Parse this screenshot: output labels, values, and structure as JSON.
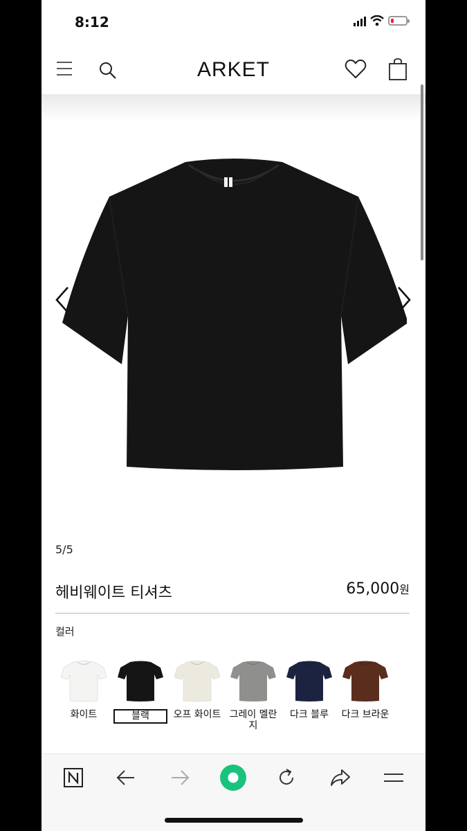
{
  "status": {
    "time": "8:12"
  },
  "brand": "ARKET",
  "gallery": {
    "counter": "5/5",
    "image_alt": "heavyweight-tshirt-black"
  },
  "product": {
    "title": "헤비웨이트 티셔츠",
    "price": "65,000",
    "currency": "원"
  },
  "colors": {
    "label": "컬러",
    "options": [
      {
        "label": "화이트",
        "hex": "#f4f4f2",
        "selected": false
      },
      {
        "label": "블랙",
        "hex": "#151515",
        "selected": true
      },
      {
        "label": "오프 화이트",
        "hex": "#ece9de",
        "selected": false
      },
      {
        "label": "그레이 멜란지",
        "hex": "#8f8f8d",
        "selected": false
      },
      {
        "label": "다크 블루",
        "hex": "#1c2340",
        "selected": false
      },
      {
        "label": "다크 브라운",
        "hex": "#5a2d1d",
        "selected": false
      }
    ]
  },
  "toolbar": {
    "accent": "#19c37d"
  }
}
